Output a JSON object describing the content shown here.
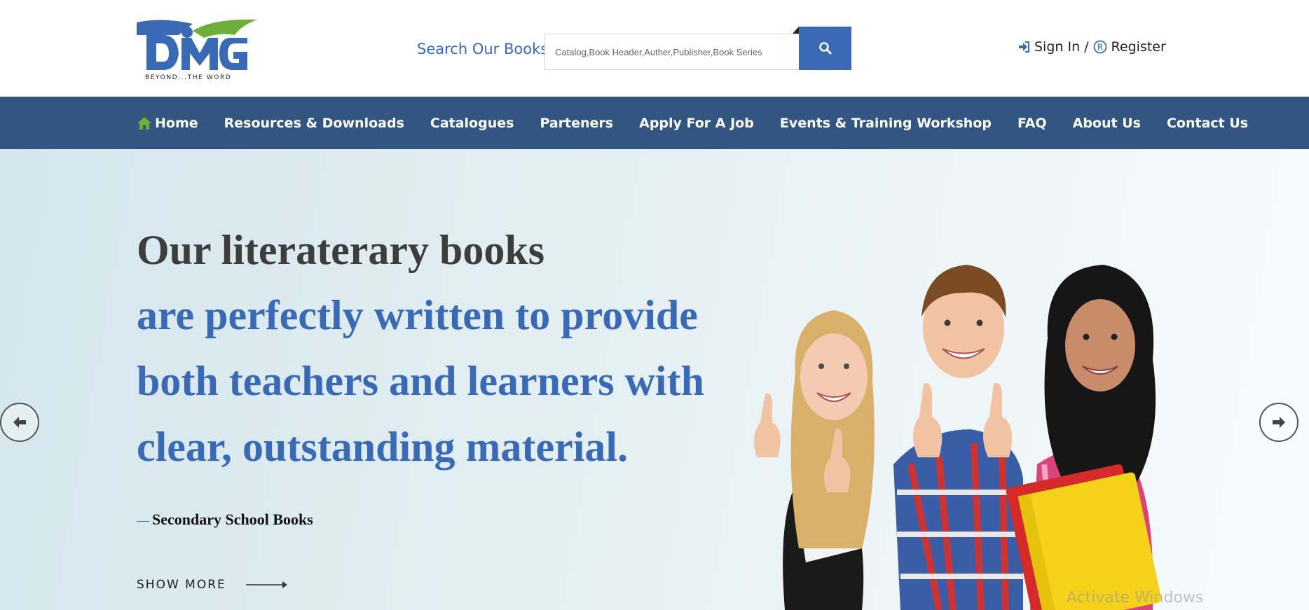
{
  "header": {
    "logo": {
      "tagline": "BEYOND...THE WORD",
      "colors": {
        "blue": "#3a6ab5",
        "green": "#6fae3b"
      }
    },
    "search": {
      "label": "Search Our Books :",
      "placeholder": "Catalog,Book Header,Auther,Publisher,Book Series",
      "button_icon": "search-icon"
    },
    "auth": {
      "sign_in_icon": "sign-in-icon",
      "sign_in_label": "Sign In",
      "separator": "/",
      "register_icon": "registered-icon",
      "register_label": "Register"
    }
  },
  "nav": {
    "background": "#325582",
    "items": [
      {
        "label": "Home",
        "icon": "home-icon"
      },
      {
        "label": "Resources & Downloads"
      },
      {
        "label": "Catalogues"
      },
      {
        "label": "Parteners"
      },
      {
        "label": "Apply For A Job"
      },
      {
        "label": "Events & Training Workshop"
      },
      {
        "label": "FAQ"
      },
      {
        "label": "About Us"
      },
      {
        "label": "Contact Us"
      }
    ]
  },
  "hero": {
    "line1": "Our literaterary books",
    "line2": "are perfectly written to provide",
    "line3": "both teachers and learners with",
    "line4": "clear, outstanding material.",
    "subtitle_dash": "—",
    "subtitle": "Secondary School Books",
    "show_more": "SHOW MORE",
    "prev_icon": "arrow-left-icon",
    "next_icon": "arrow-right-icon",
    "image": "students-thumbs-up"
  },
  "watermark": "Activate Windows",
  "colors": {
    "accent": "#3a6ab5",
    "nav": "#325582",
    "text_dark": "#3d3d3d"
  }
}
